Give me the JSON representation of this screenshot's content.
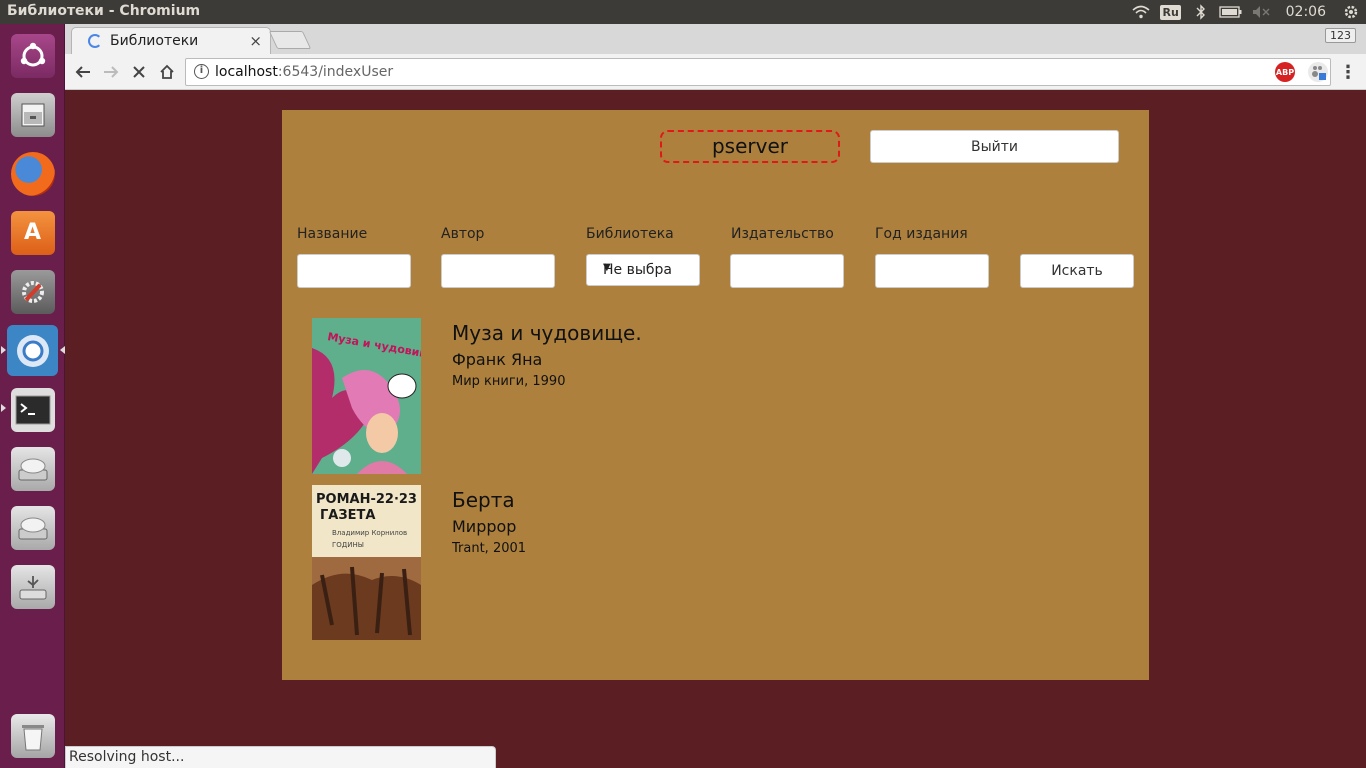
{
  "window_title": "Библиотеки - Chromium",
  "tray": {
    "keyboard": "Ru",
    "clock": "02:06"
  },
  "launcher": [
    "ubuntu-dash",
    "files",
    "firefox",
    "software-center",
    "system-settings",
    "chromium",
    "terminal",
    "disk-1",
    "disk-2",
    "usb-drive",
    "trash"
  ],
  "browser": {
    "tab_title": "Библиотеки",
    "tab_close": "×",
    "badge": "123",
    "url_host": "localhost",
    "url_rest": ":6543/indexUser",
    "abp": "ABP"
  },
  "header": {
    "username": "pserver",
    "logout_label": "Выйти"
  },
  "filters": {
    "title_label": "Название",
    "author_label": "Автор",
    "library_label": "Библиотека",
    "library_value": "Не выбрано",
    "publisher_label": "Издательство",
    "year_label": "Год издания",
    "search_label": "Искать"
  },
  "books": [
    {
      "title": "Муза и чудовище.",
      "author": "Франк Яна",
      "publication": "Мир книги, 1990",
      "cover_text": "Муза и чудовище"
    },
    {
      "title": "Берта",
      "author": "Миррор",
      "publication": "Trant, 2001",
      "cover_text_1": "РОМАН-22·23",
      "cover_text_2": "ГАЗЕТА",
      "cover_text_3": "Владимир Корнилов",
      "cover_text_4": "ГОДИНЫ"
    }
  ],
  "status": "Resolving host..."
}
